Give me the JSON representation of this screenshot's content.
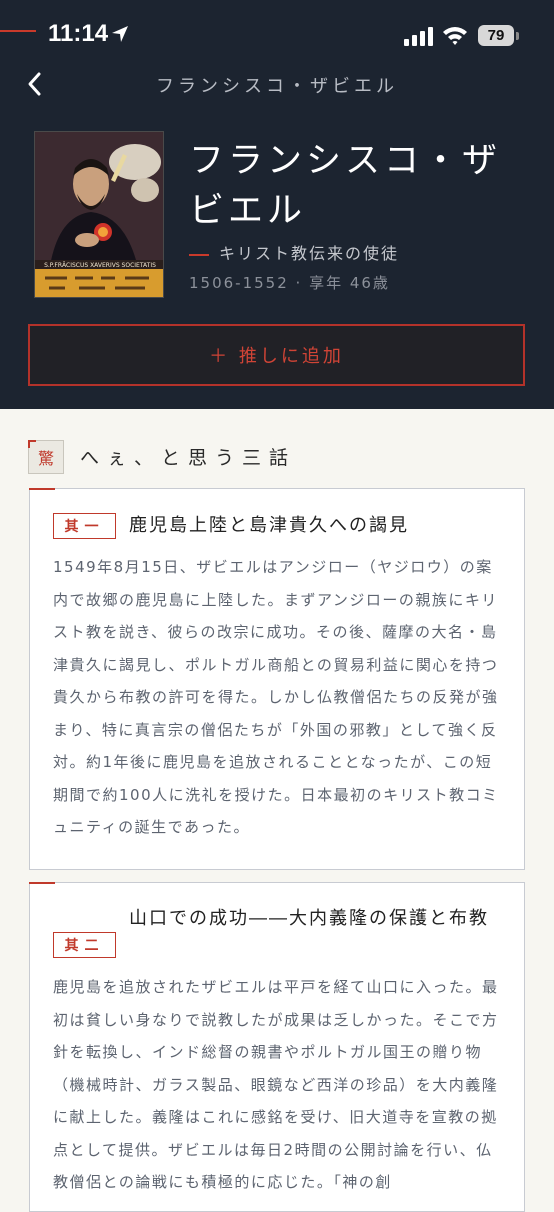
{
  "status_bar": {
    "time": "11:14",
    "battery": "79"
  },
  "nav": {
    "title": "フランシスコ・ザビエル",
    "back_icon": "chevron-left-icon"
  },
  "profile": {
    "name": "フランシスコ・ザビエル",
    "subtitle": "キリスト教伝来の使徒",
    "years": "1506-1552 · 享年 46歳",
    "portrait_inscription": "S.P.FRĀCISCUS XAVERIVS SOCIETATIS"
  },
  "oshi_button": {
    "label": "＋ 推しに追加"
  },
  "section": {
    "kanji": "驚",
    "title": "へぇ、と思う三話"
  },
  "stories": [
    {
      "label": "其一",
      "heading": "鹿児島上陸と島津貴久への謁見",
      "body": "1549年8月15日、ザビエルはアンジロー（ヤジロウ）の案内で故郷の鹿児島に上陸した。まずアンジローの親族にキリスト教を説き、彼らの改宗に成功。その後、薩摩の大名・島津貴久に謁見し、ポルトガル商船との貿易利益に関心を持つ貴久から布教の許可を得た。しかし仏教僧侶たちの反発が強まり、特に真言宗の僧侶たちが「外国の邪教」として強く反対。約1年後に鹿児島を追放されることとなったが、この短期間で約100人に洗礼を授けた。日本最初のキリスト教コミュニティの誕生であった。"
    },
    {
      "label": "其二",
      "heading": "山口での成功――大内義隆の保護と布教",
      "body": "鹿児島を追放されたザビエルは平戸を経て山口に入った。最初は貧しい身なりで説教したが成果は乏しかった。そこで方針を転換し、インド総督の親書やポルトガル国王の贈り物（機械時計、ガラス製品、眼鏡など西洋の珍品）を大内義隆に献上した。義隆はこれに感銘を受け、旧大道寺を宣教の拠点として提供。ザビエルは毎日2時間の公開討論を行い、仏教僧侶との論戦にも積極的に応じた。「神の創"
    }
  ],
  "colors": {
    "header_bg": "#1c2430",
    "accent_red": "#c0392b",
    "page_bg": "#f7f6f1"
  }
}
